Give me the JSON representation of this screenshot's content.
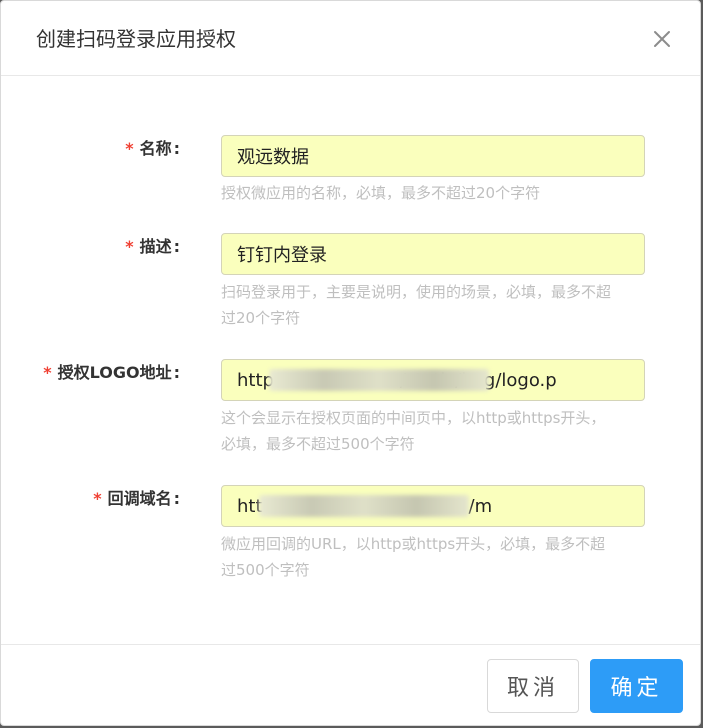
{
  "dialog": {
    "title": "创建扫码登录应用授权"
  },
  "form": {
    "fields": [
      {
        "label": "名称",
        "value": "观远数据",
        "hint_line1": "授权微应用的名称，必填，最多不超过20个字符",
        "hint_line2": ""
      },
      {
        "label": "描述",
        "value": "钉钉内登录",
        "hint_line1": "扫码登录用于，主要是说明，使用的场景，必填，最多不超",
        "hint_line2": "过20个字符"
      },
      {
        "label": "授权LOGO地址",
        "value": "http                      /static/img/logo.p",
        "hint_line1": "这个会显示在授权页面的中间页中，以http或https开头，",
        "hint_line2": "必填，最多不超过500个字符"
      },
      {
        "label": "回调域名",
        "value": "htt                                    /m",
        "hint_line1": "微应用回调的URL，以http或https开头，必填，最多不超",
        "hint_line2": "过500个字符"
      }
    ],
    "required_mark": "*",
    "colon": ":"
  },
  "footer": {
    "cancel_label": "取消",
    "ok_label": "确定"
  },
  "colors": {
    "primary": "#2d9cf7",
    "required": "#f04134",
    "autofill_bg": "#faffbd"
  }
}
